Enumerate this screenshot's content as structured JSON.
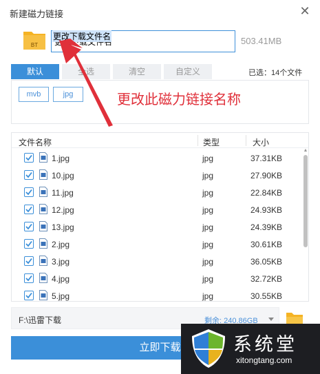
{
  "window": {
    "title": "新建磁力链接",
    "close_icon": "close-icon"
  },
  "torrent": {
    "icon_label": "BT",
    "name_value": "更改下载文件名",
    "total_size": "503.41MB"
  },
  "tabs": [
    {
      "label": "默认",
      "active": true
    },
    {
      "label": "全选",
      "active": false
    },
    {
      "label": "清空",
      "active": false
    },
    {
      "label": "自定义",
      "active": false
    }
  ],
  "selected_count": "已选：14个文件",
  "filters": [
    {
      "label": "mvb"
    },
    {
      "label": "jpg"
    }
  ],
  "annotation": "更改此磁力链接名称",
  "file_list": {
    "columns": [
      "文件名称",
      "类型",
      "大小"
    ],
    "rows": [
      {
        "name": "1.jpg",
        "type": "jpg",
        "size": "37.31KB",
        "checked": true
      },
      {
        "name": "10.jpg",
        "type": "jpg",
        "size": "27.90KB",
        "checked": true
      },
      {
        "name": "11.jpg",
        "type": "jpg",
        "size": "22.84KB",
        "checked": true
      },
      {
        "name": "12.jpg",
        "type": "jpg",
        "size": "24.93KB",
        "checked": true
      },
      {
        "name": "13.jpg",
        "type": "jpg",
        "size": "24.39KB",
        "checked": true
      },
      {
        "name": "2.jpg",
        "type": "jpg",
        "size": "30.61KB",
        "checked": true
      },
      {
        "name": "3.jpg",
        "type": "jpg",
        "size": "36.05KB",
        "checked": true
      },
      {
        "name": "4.jpg",
        "type": "jpg",
        "size": "32.72KB",
        "checked": true
      },
      {
        "name": "5.jpg",
        "type": "jpg",
        "size": "30.55KB",
        "checked": true
      }
    ]
  },
  "save": {
    "path": "F:\\迅雷下载",
    "free_space": "剩余: 240.86GB"
  },
  "download_button": "立即下载",
  "watermark": {
    "brand": "系统堂",
    "url": "xitongtang.com"
  },
  "colors": {
    "accent": "#3b8fd9",
    "annotation": "#e0303a",
    "folder": "#f5b324"
  }
}
